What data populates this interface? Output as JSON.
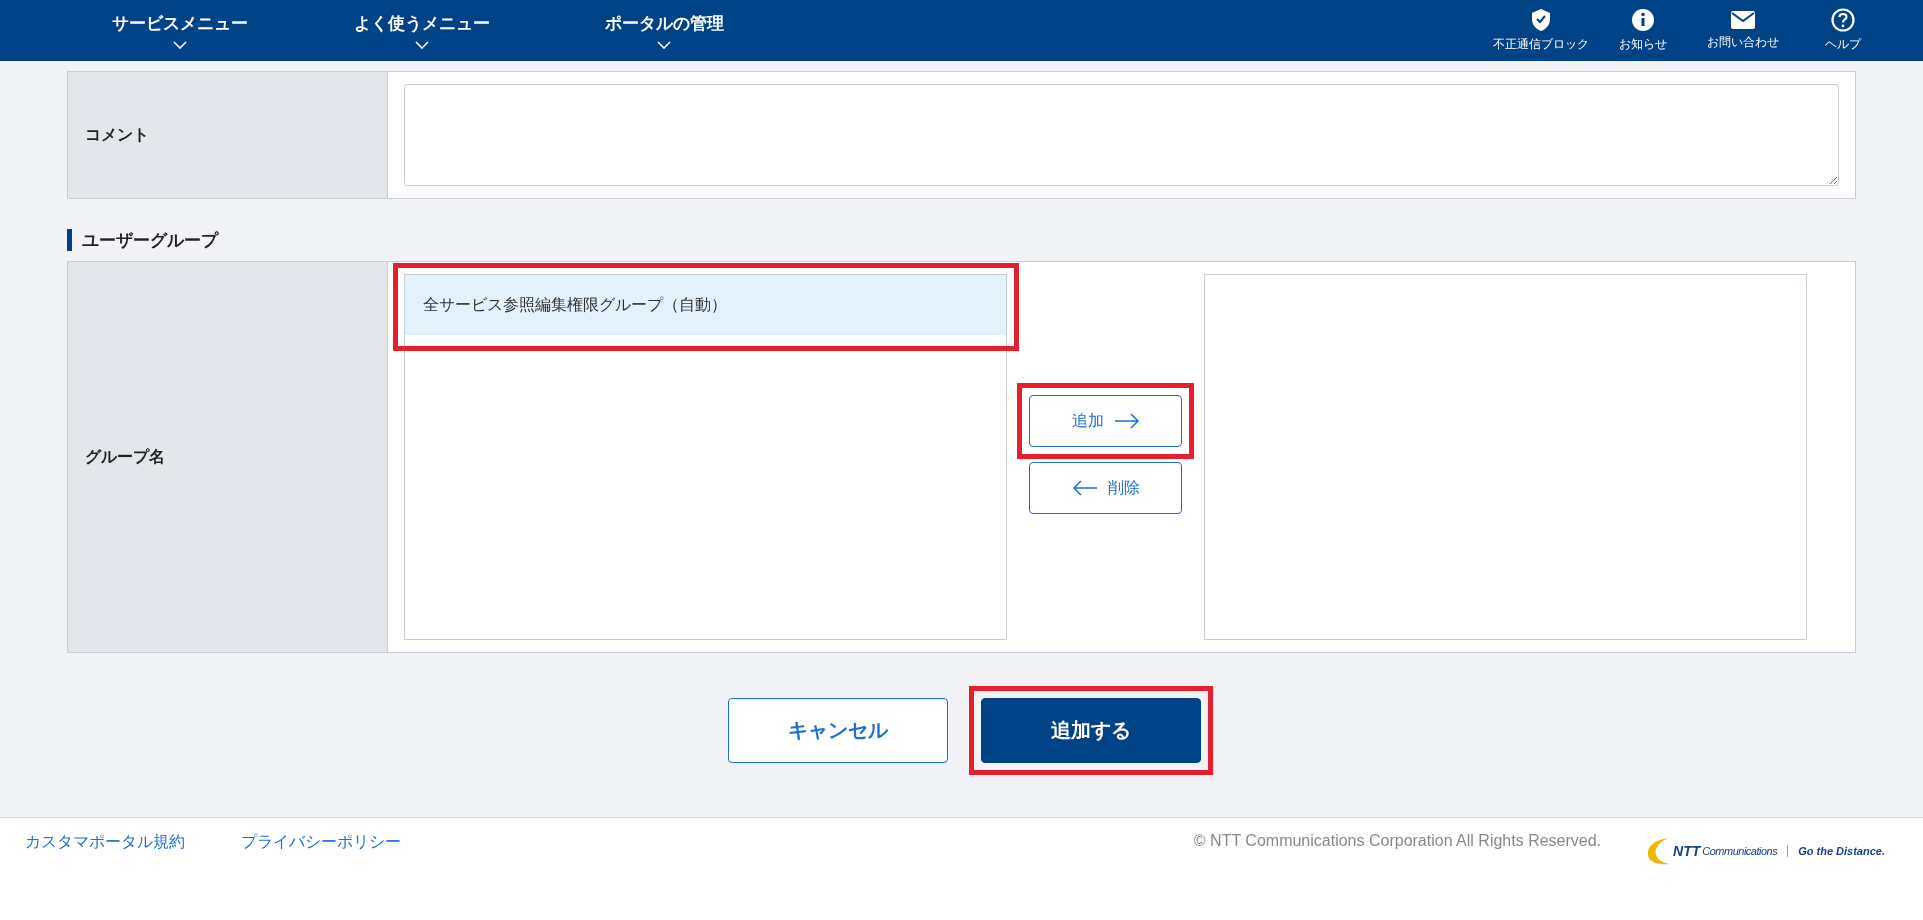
{
  "header": {
    "menus": [
      {
        "label": "サービスメニュー"
      },
      {
        "label": "よく使うメニュー"
      },
      {
        "label": "ポータルの管理"
      }
    ],
    "tools": [
      {
        "kind": "shield",
        "label": "不正通信ブロック"
      },
      {
        "kind": "info",
        "label": "お知らせ"
      },
      {
        "kind": "mail",
        "label": "お問い合わせ"
      },
      {
        "kind": "help",
        "label": "ヘルプ"
      }
    ]
  },
  "comment": {
    "label": "コメント"
  },
  "user_group": {
    "heading": "ユーザーグループ",
    "label": "グループ名",
    "available": [
      {
        "label": "全サービス参照編集権限グループ（自動）",
        "selected": true,
        "highlighted": true
      }
    ],
    "add_button": {
      "label": "追加",
      "highlighted": true
    },
    "remove_button": {
      "label": "削除",
      "highlighted": false
    }
  },
  "actions": {
    "cancel": {
      "label": "キャンセル",
      "highlighted": false
    },
    "submit": {
      "label": "追加する",
      "highlighted": true
    }
  },
  "footer": {
    "links": [
      "カスタマポータル規約",
      "プライバシーポリシー"
    ],
    "copyright": "© NTT Communications Corporation All Rights Reserved.",
    "logo": {
      "brand": "NTT",
      "name": "Communications",
      "tagline": "Go the Distance."
    }
  }
}
